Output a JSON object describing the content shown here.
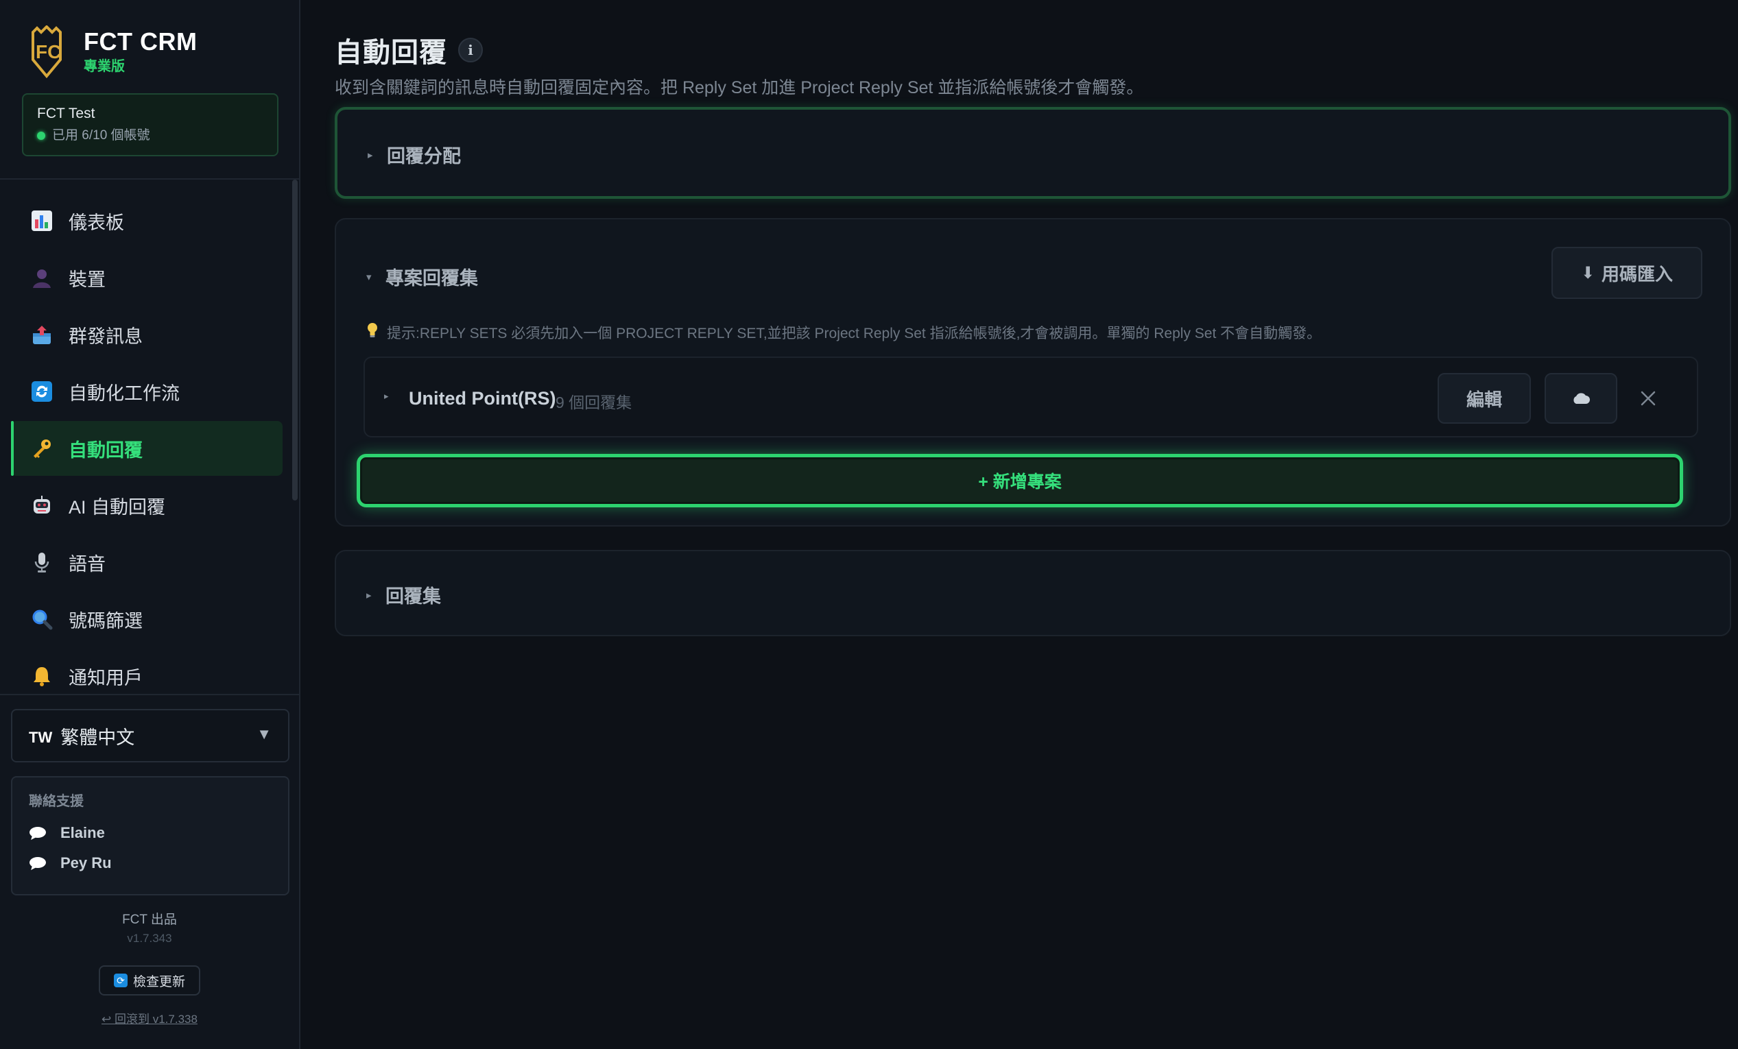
{
  "brand": {
    "name": "FCT CRM",
    "edition": "專業版"
  },
  "account": {
    "name": "FCT Test",
    "usage": "已用 6/10 個帳號",
    "status_color": "#2dd36f"
  },
  "sidebar": {
    "items": [
      {
        "label": "儀表板",
        "icon": "bar-chart-icon",
        "active": false
      },
      {
        "label": "裝置",
        "icon": "user-silhouette-icon",
        "active": false
      },
      {
        "label": "群發訊息",
        "icon": "outbox-tray-icon",
        "active": false
      },
      {
        "label": "自動化工作流",
        "icon": "refresh-arrows-icon",
        "active": false
      },
      {
        "label": "自動回覆",
        "icon": "key-icon",
        "active": true
      },
      {
        "label": "AI 自動回覆",
        "icon": "robot-icon",
        "active": false
      },
      {
        "label": "語音",
        "icon": "microphone-icon",
        "active": false
      },
      {
        "label": "號碼篩選",
        "icon": "magnifier-icon",
        "active": false
      },
      {
        "label": "通知用戶",
        "icon": "bell-icon",
        "active": false
      }
    ]
  },
  "language": {
    "flag": "TW",
    "label": "繁體中文"
  },
  "support": {
    "title": "聯絡支援",
    "contacts": [
      "Elaine",
      "Pey Ru"
    ]
  },
  "footer": {
    "brand": "FCT 出品",
    "version": "v1.7.343",
    "check_update": "檢查更新",
    "rollback": "↩ 回滾到 v1.7.338"
  },
  "page": {
    "title": "自動回覆",
    "subtitle": "收到含關鍵詞的訊息時自動回覆固定內容。把 Reply Set 加進 Project Reply Set 並指派給帳號後才會觸發。"
  },
  "sections": {
    "assignment": {
      "title": "回覆分配",
      "expanded": false
    },
    "project_sets": {
      "title": "專案回覆集",
      "expanded": true,
      "import_label": "用碼匯入",
      "hint": "提示:REPLY SETS 必須先加入一個 PROJECT REPLY SET,並把該 Project Reply Set 指派給帳號後,才會被調用。單獨的 Reply Set 不會自動觸發。",
      "projects": [
        {
          "name": "United Point(RS)",
          "count": "9 個回覆集",
          "edit_label": "編輯"
        }
      ],
      "add_label": "+ 新增專案"
    },
    "reply_sets": {
      "title": "回覆集",
      "expanded": false
    }
  },
  "colors": {
    "accent": "#2dd36f",
    "background": "#0d1117",
    "sidebar": "#10151d"
  }
}
